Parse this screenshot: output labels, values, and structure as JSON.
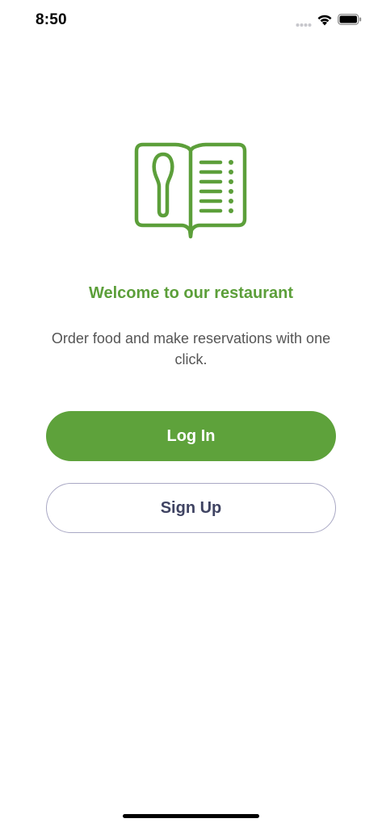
{
  "status_bar": {
    "time": "8:50"
  },
  "logo": {
    "icon": "menu-book-spoon-icon",
    "color": "#5c9f3a"
  },
  "welcome": {
    "title": "Welcome to our restaurant",
    "subtitle": "Order food and make reservations with one click."
  },
  "actions": {
    "login_label": "Log In",
    "signup_label": "Sign Up"
  },
  "colors": {
    "accent": "#5ea23b",
    "signup_text": "#3f4362",
    "body_text": "#555555"
  }
}
